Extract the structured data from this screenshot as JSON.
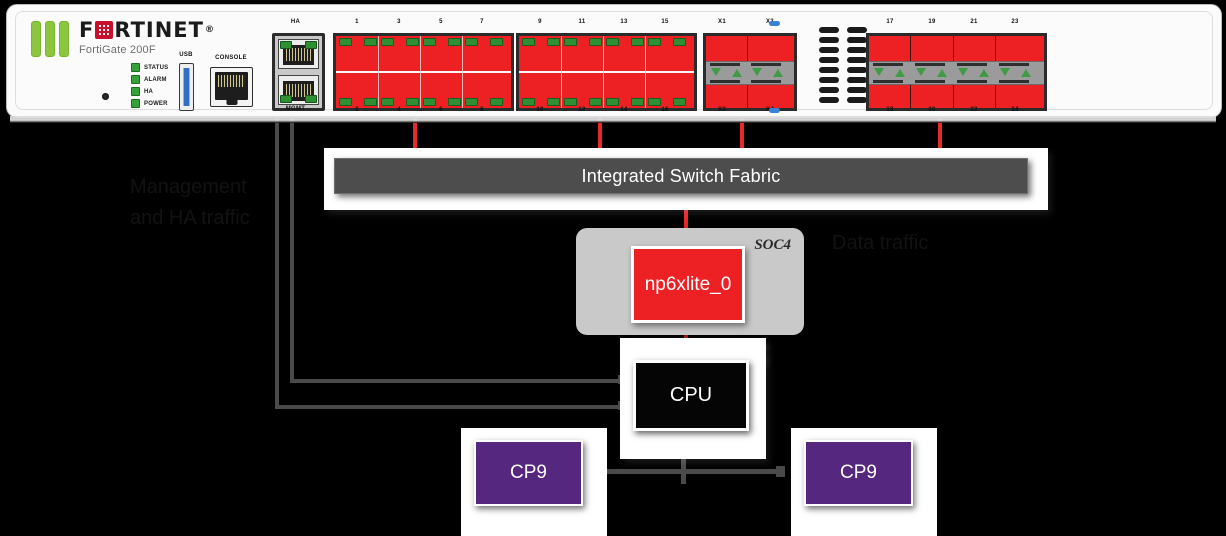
{
  "device": {
    "brand": "F□RTINET",
    "brand_plain": "FORTINET",
    "registered_mark": "®",
    "model": "FortiGate 200F",
    "leds": [
      {
        "label": "STATUS",
        "color": "#36a03a"
      },
      {
        "label": "ALARM",
        "color": "#36a03a"
      },
      {
        "label": "HA",
        "color": "#36a03a"
      },
      {
        "label": "POWER",
        "color": "#36a03a"
      }
    ],
    "usb_label": "USB",
    "console_label": "CONSOLE",
    "ha_label": "HA",
    "mgmt_label": "MGMT",
    "bank1": {
      "top_numbers": [
        "1",
        "3",
        "5",
        "7"
      ],
      "bottom_numbers": [
        "2",
        "4",
        "6",
        "8"
      ]
    },
    "bank2": {
      "top_numbers": [
        "9",
        "11",
        "13",
        "15"
      ],
      "bottom_numbers": [
        "10",
        "12",
        "14",
        "16"
      ]
    },
    "sfp_small": {
      "top_numbers": [
        "X1",
        "X3"
      ],
      "bottom_numbers": [
        "X2",
        "X4"
      ]
    },
    "bank3": {
      "top_numbers": [
        "17",
        "19",
        "21",
        "23"
      ],
      "bottom_numbers": [
        "18",
        "20",
        "22",
        "24"
      ]
    }
  },
  "diagram": {
    "switch_fabric": "Integrated Switch Fabric",
    "soc_label": "SOC4",
    "np_label": "np6xlite_0",
    "cpu_label": "CPU",
    "cp9_left_label": "CP9",
    "cp9_right_label": "CP9",
    "mgmt_note": "Management\nand HA traffic",
    "right_note": "Data traffic",
    "colors": {
      "red": "#ed2024",
      "purple": "#56277e",
      "fabric_gray": "#4d4d4d",
      "soc_gray": "#c9c9c9",
      "cpu_black": "#050505",
      "line_gray": "#4a4a4a"
    }
  }
}
